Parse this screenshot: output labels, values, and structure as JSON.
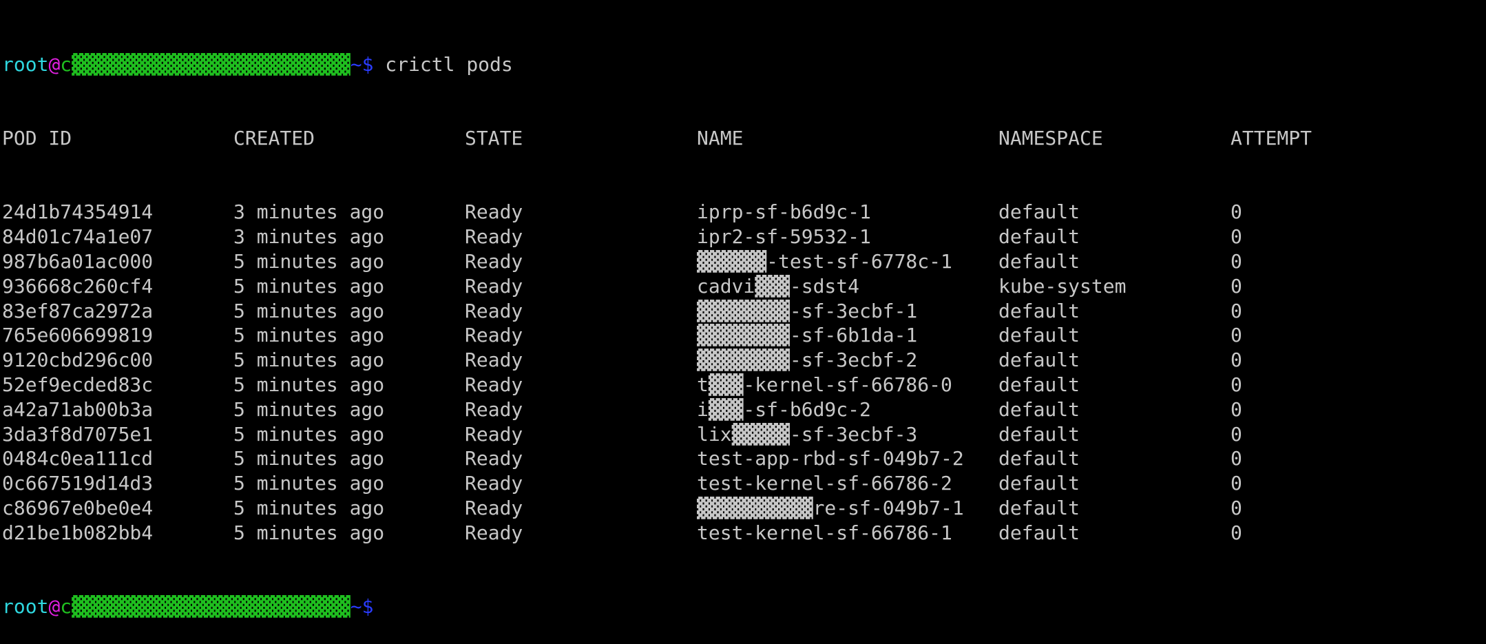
{
  "prompt": {
    "user": "root",
    "at": "@",
    "host": "c▓▓▓▓▓▓▓▓▓▓▓▓▓▓▓▓▓▓▓▓▓▓▓▓",
    "path_prompt": "~$",
    "command": " crictl pods"
  },
  "columns": [
    "POD ID",
    "CREATED",
    "STATE",
    "NAME",
    "NAMESPACE",
    "ATTEMPT"
  ],
  "rows": [
    [
      "24d1b74354914",
      "3 minutes ago",
      "Ready",
      "iprp-sf-b6d9c-1",
      "default",
      "0"
    ],
    [
      "84d01c74a1e07",
      "3 minutes ago",
      "Ready",
      "ipr2-sf-59532-1",
      "default",
      "0"
    ],
    [
      "987b6a01ac000",
      "5 minutes ago",
      "Ready",
      "▓▓▓▓▓▓-test-sf-6778c-1",
      "default",
      "0"
    ],
    [
      "936668c260cf4",
      "5 minutes ago",
      "Ready",
      "cadvi▓▓▓-sdst4",
      "kube-system",
      "0"
    ],
    [
      "83ef87ca2972a",
      "5 minutes ago",
      "Ready",
      "▓▓▓▓▓▓▓▓-sf-3ecbf-1",
      "default",
      "0"
    ],
    [
      "765e606699819",
      "5 minutes ago",
      "Ready",
      "▓▓▓▓▓▓▓▓-sf-6b1da-1",
      "default",
      "0"
    ],
    [
      "9120cbd296c00",
      "5 minutes ago",
      "Ready",
      "▓▓▓▓▓▓▓▓-sf-3ecbf-2",
      "default",
      "0"
    ],
    [
      "52ef9ecded83c",
      "5 minutes ago",
      "Ready",
      "t▓▓▓-kernel-sf-66786-0",
      "default",
      "0"
    ],
    [
      "a42a71ab00b3a",
      "5 minutes ago",
      "Ready",
      "i▓▓▓-sf-b6d9c-2",
      "default",
      "0"
    ],
    [
      "3da3f8d7075e1",
      "5 minutes ago",
      "Ready",
      "lix▓▓▓▓▓-sf-3ecbf-3",
      "default",
      "0"
    ],
    [
      "0484c0ea111cd",
      "5 minutes ago",
      "Ready",
      "test-app-rbd-sf-049b7-2",
      "default",
      "0"
    ],
    [
      "0c667519d14d3",
      "5 minutes ago",
      "Ready",
      "test-kernel-sf-66786-2",
      "default",
      "0"
    ],
    [
      "c86967e0be0e4",
      "5 minutes ago",
      "Ready",
      "▓▓▓▓▓▓▓▓▓▓re-sf-049b7-1",
      "default",
      "0"
    ],
    [
      "d21be1b082bb4",
      "5 minutes ago",
      "Ready",
      "test-kernel-sf-66786-1",
      "default",
      "0"
    ]
  ],
  "colors": {
    "user": "#2fd8e0",
    "at": "#e020e0",
    "host": "#28c828",
    "prompt": "#2a3cff",
    "text": "#c7c7c7",
    "background": "#000000"
  }
}
